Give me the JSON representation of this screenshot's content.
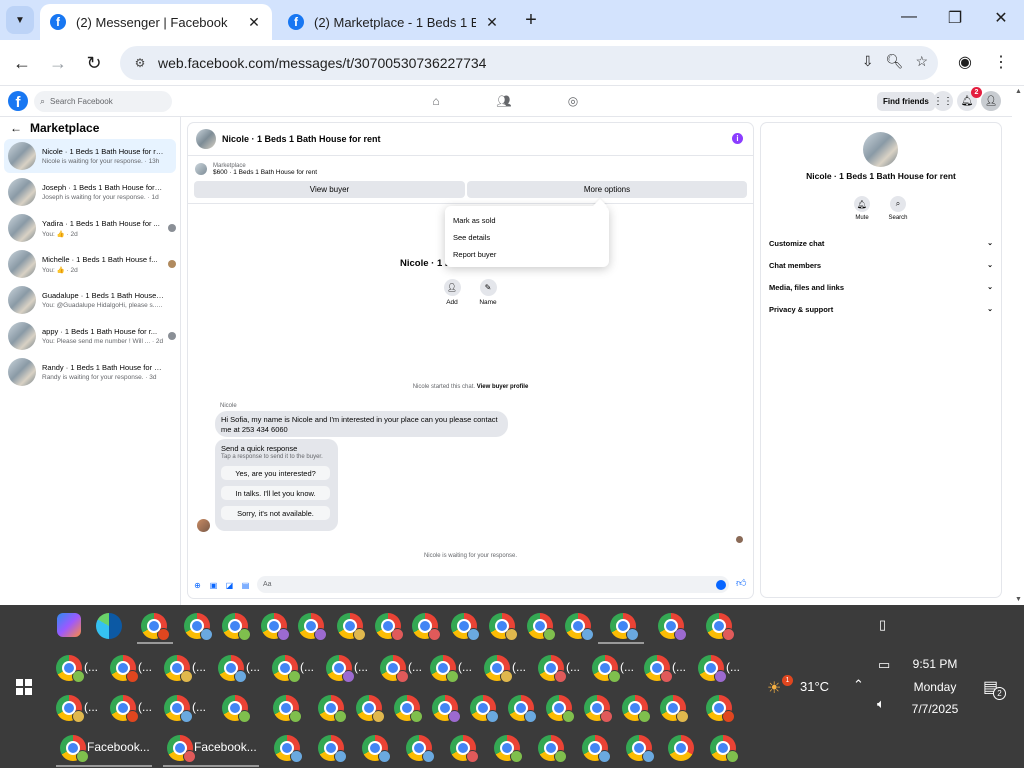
{
  "browser": {
    "tabs": [
      {
        "title": "(2) Messenger | Facebook",
        "active": true
      },
      {
        "title": "(2) Marketplace - 1 Beds 1 Bath",
        "active": false
      }
    ],
    "url": "web.facebook.com/messages/t/30700530736227734"
  },
  "fb_nav": {
    "search_placeholder": "Search Facebook",
    "find_friends": "Find friends",
    "notification_count": "2"
  },
  "left_panel": {
    "header": "Marketplace",
    "conversations": [
      {
        "name": "Nicole · 1 Beds 1 Bath House for rent",
        "preview": "Nicole is waiting for your response. · 13h",
        "selected": true
      },
      {
        "name": "Joseph · 1 Beds 1 Bath House for re...",
        "preview": "Joseph is waiting for your response. · 1d",
        "selected": false
      },
      {
        "name": "Yadira · 1 Beds 1 Bath House for ...",
        "preview": "You: 👍 · 2d",
        "selected": false
      },
      {
        "name": "Michelle · 1 Beds 1 Bath House f...",
        "preview": "You: 👍 · 2d",
        "selected": false
      },
      {
        "name": "Guadalupe · 1 Beds 1 Bath House f...",
        "preview": "You: @Guadalupe HidalgoHi, please s... · 2d",
        "selected": false
      },
      {
        "name": "appy · 1 Beds 1 Bath House for r...",
        "preview": "You: Please send me number ! Will ... · 2d",
        "selected": false
      },
      {
        "name": "Randy · 1 Beds 1 Bath House for rent",
        "preview": "Randy is waiting for your response. · 3d",
        "selected": false
      }
    ]
  },
  "chat": {
    "title": "Nicole · 1 Beds 1 Bath House for rent",
    "marketplace_label": "Marketplace",
    "listing": "$600 · 1 Beds 1 Bath House for rent",
    "view_buyer": "View buyer",
    "more_options": "More options",
    "center_name": "Nicole · 1 Be",
    "add_label": "Add",
    "name_label": "Name",
    "started_text": "Nicole started this chat.",
    "view_profile": "View buyer profile",
    "sender": "Nicole",
    "message": "Hi Sofia, my name is Nicole and I'm interested in your place can you please contact me at 253 434 6060",
    "quick_title": "Send a quick response",
    "quick_sub": "Tap a response to send it to the buyer.",
    "quick_options": [
      "Yes, are you interested?",
      "In talks. I'll let you know.",
      "Sorry, it's not available."
    ],
    "waiting": "Nicole is waiting for your response.",
    "composer_placeholder": "Aa"
  },
  "menu": {
    "items": [
      "Mark as sold",
      "See details",
      "Report buyer"
    ]
  },
  "right_panel": {
    "name": "Nicole · 1 Beds 1 Bath House for rent",
    "mute": "Mute",
    "search": "Search",
    "rows": [
      "Customize chat",
      "Chat members",
      "Media, files and links",
      "Privacy & support"
    ]
  },
  "taskbar": {
    "weather_temp": "31°C",
    "weather_badge": "1",
    "time": "9:51 PM",
    "day": "Monday",
    "date": "7/7/2025",
    "notif_count": "2",
    "ellipsis": "(...",
    "facebook_label": "Facebook..."
  },
  "colors": {
    "fb_blue": "#1877f2",
    "tabstrip": "#d3e3fd",
    "taskbar": "#3b3b3b",
    "selected_conv": "#e7f3ff"
  }
}
